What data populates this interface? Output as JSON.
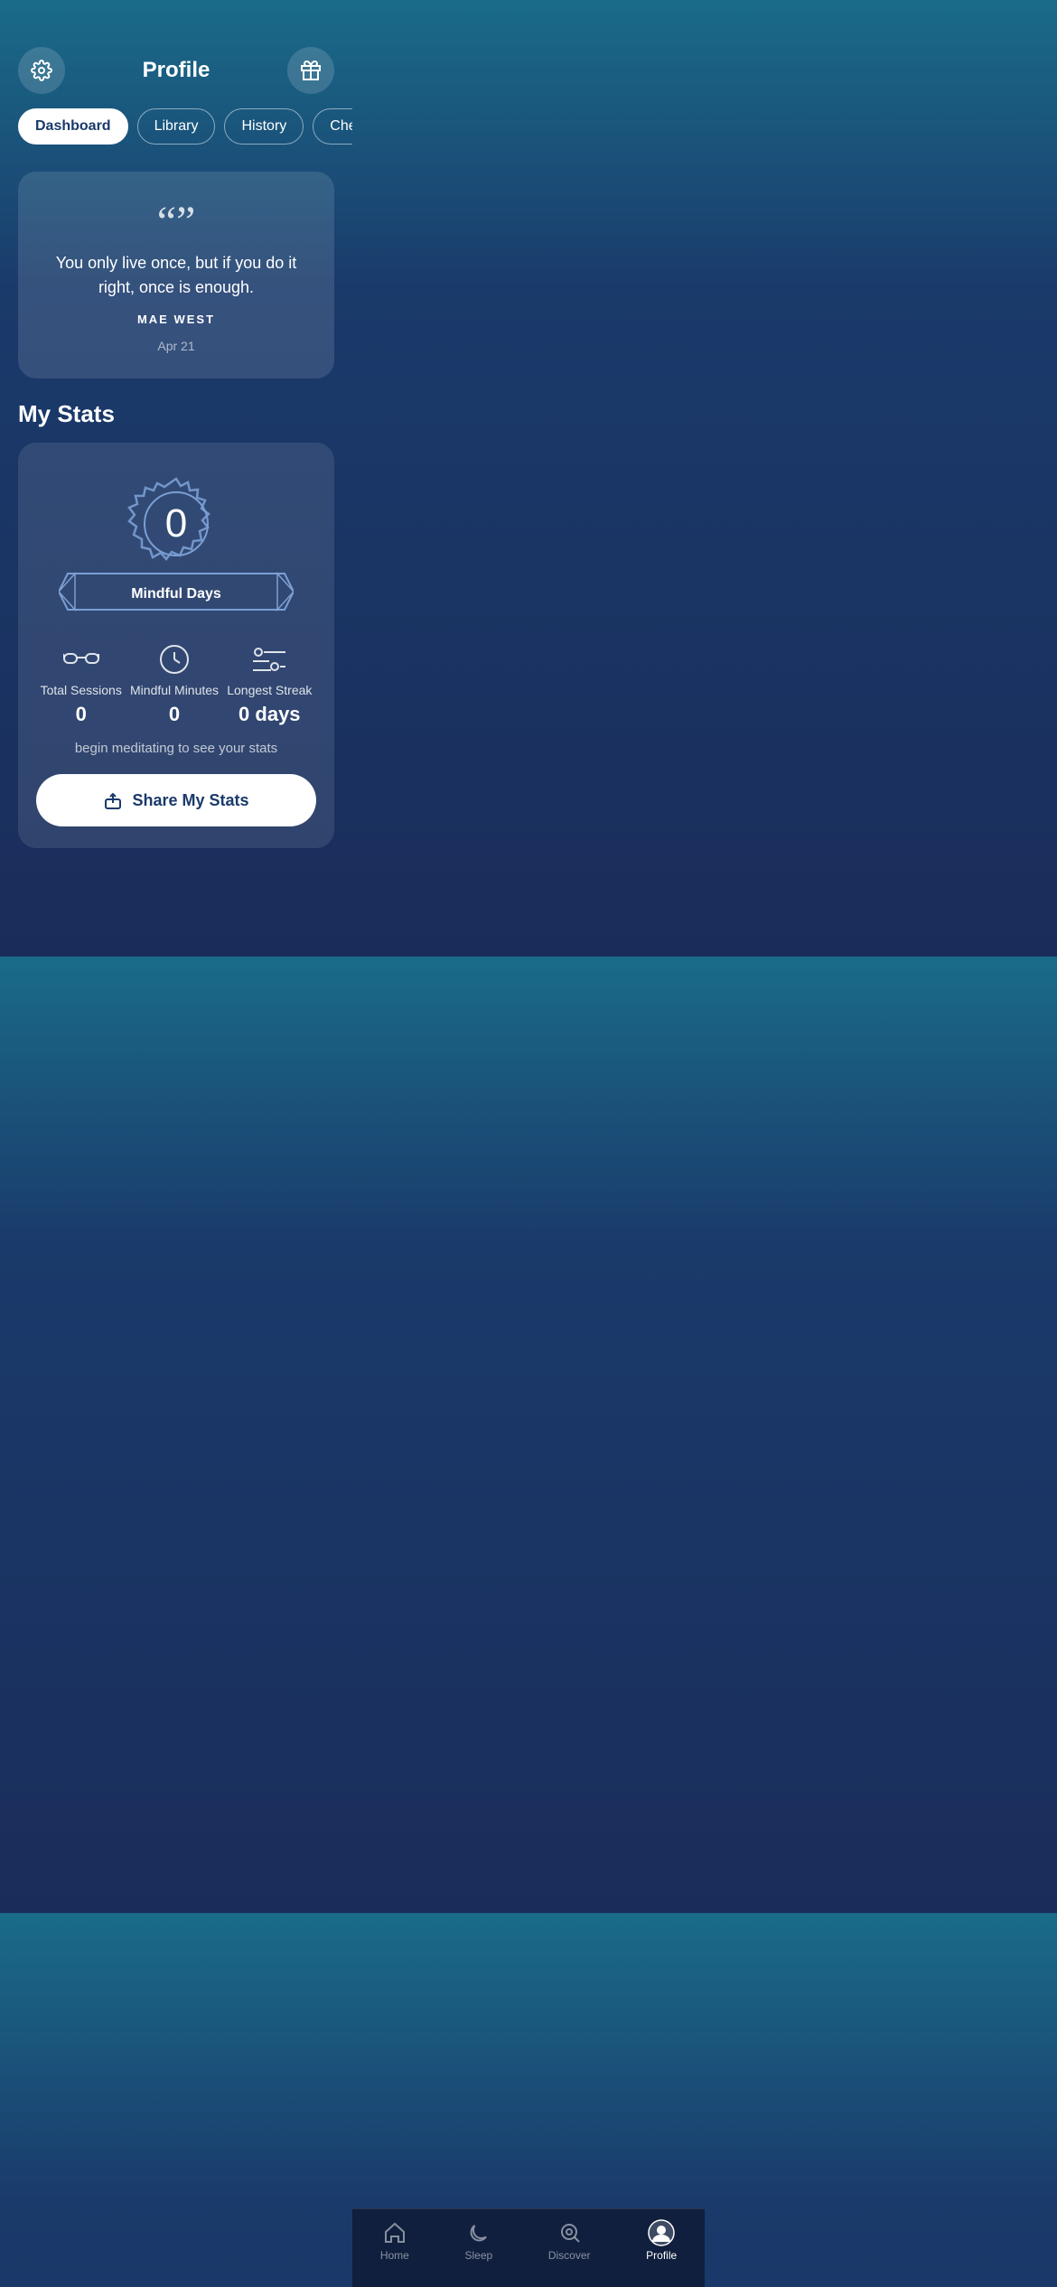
{
  "header": {
    "title": "Profile",
    "settings_label": "settings-icon",
    "gift_label": "gift-icon"
  },
  "tabs": [
    {
      "label": "Dashboard",
      "active": true
    },
    {
      "label": "Library",
      "active": false
    },
    {
      "label": "History",
      "active": false
    },
    {
      "label": "Check-Ins",
      "active": false
    }
  ],
  "quote_card": {
    "quote_mark": "“”",
    "quote_text": "You only live once, but if you do it right, once is enough.",
    "author": "MAE WEST",
    "date": "Apr 21"
  },
  "my_stats": {
    "section_label": "My Stats",
    "badge": {
      "value": "0",
      "label": "Mindful Days"
    },
    "stats": [
      {
        "icon": "glasses-icon",
        "label": "Total Sessions",
        "value": "0"
      },
      {
        "icon": "clock-icon",
        "label": "Mindful Minutes",
        "value": "0"
      },
      {
        "icon": "streak-icon",
        "label": "Longest Streak",
        "value": "0 days"
      }
    ],
    "hint": "begin meditating to see your stats",
    "share_button": "Share My Stats"
  },
  "bottom_nav": [
    {
      "icon": "home-icon",
      "label": "Home",
      "active": false
    },
    {
      "icon": "sleep-icon",
      "label": "Sleep",
      "active": false
    },
    {
      "icon": "discover-icon",
      "label": "Discover",
      "active": false
    },
    {
      "icon": "profile-icon",
      "label": "Profile",
      "active": true
    }
  ]
}
